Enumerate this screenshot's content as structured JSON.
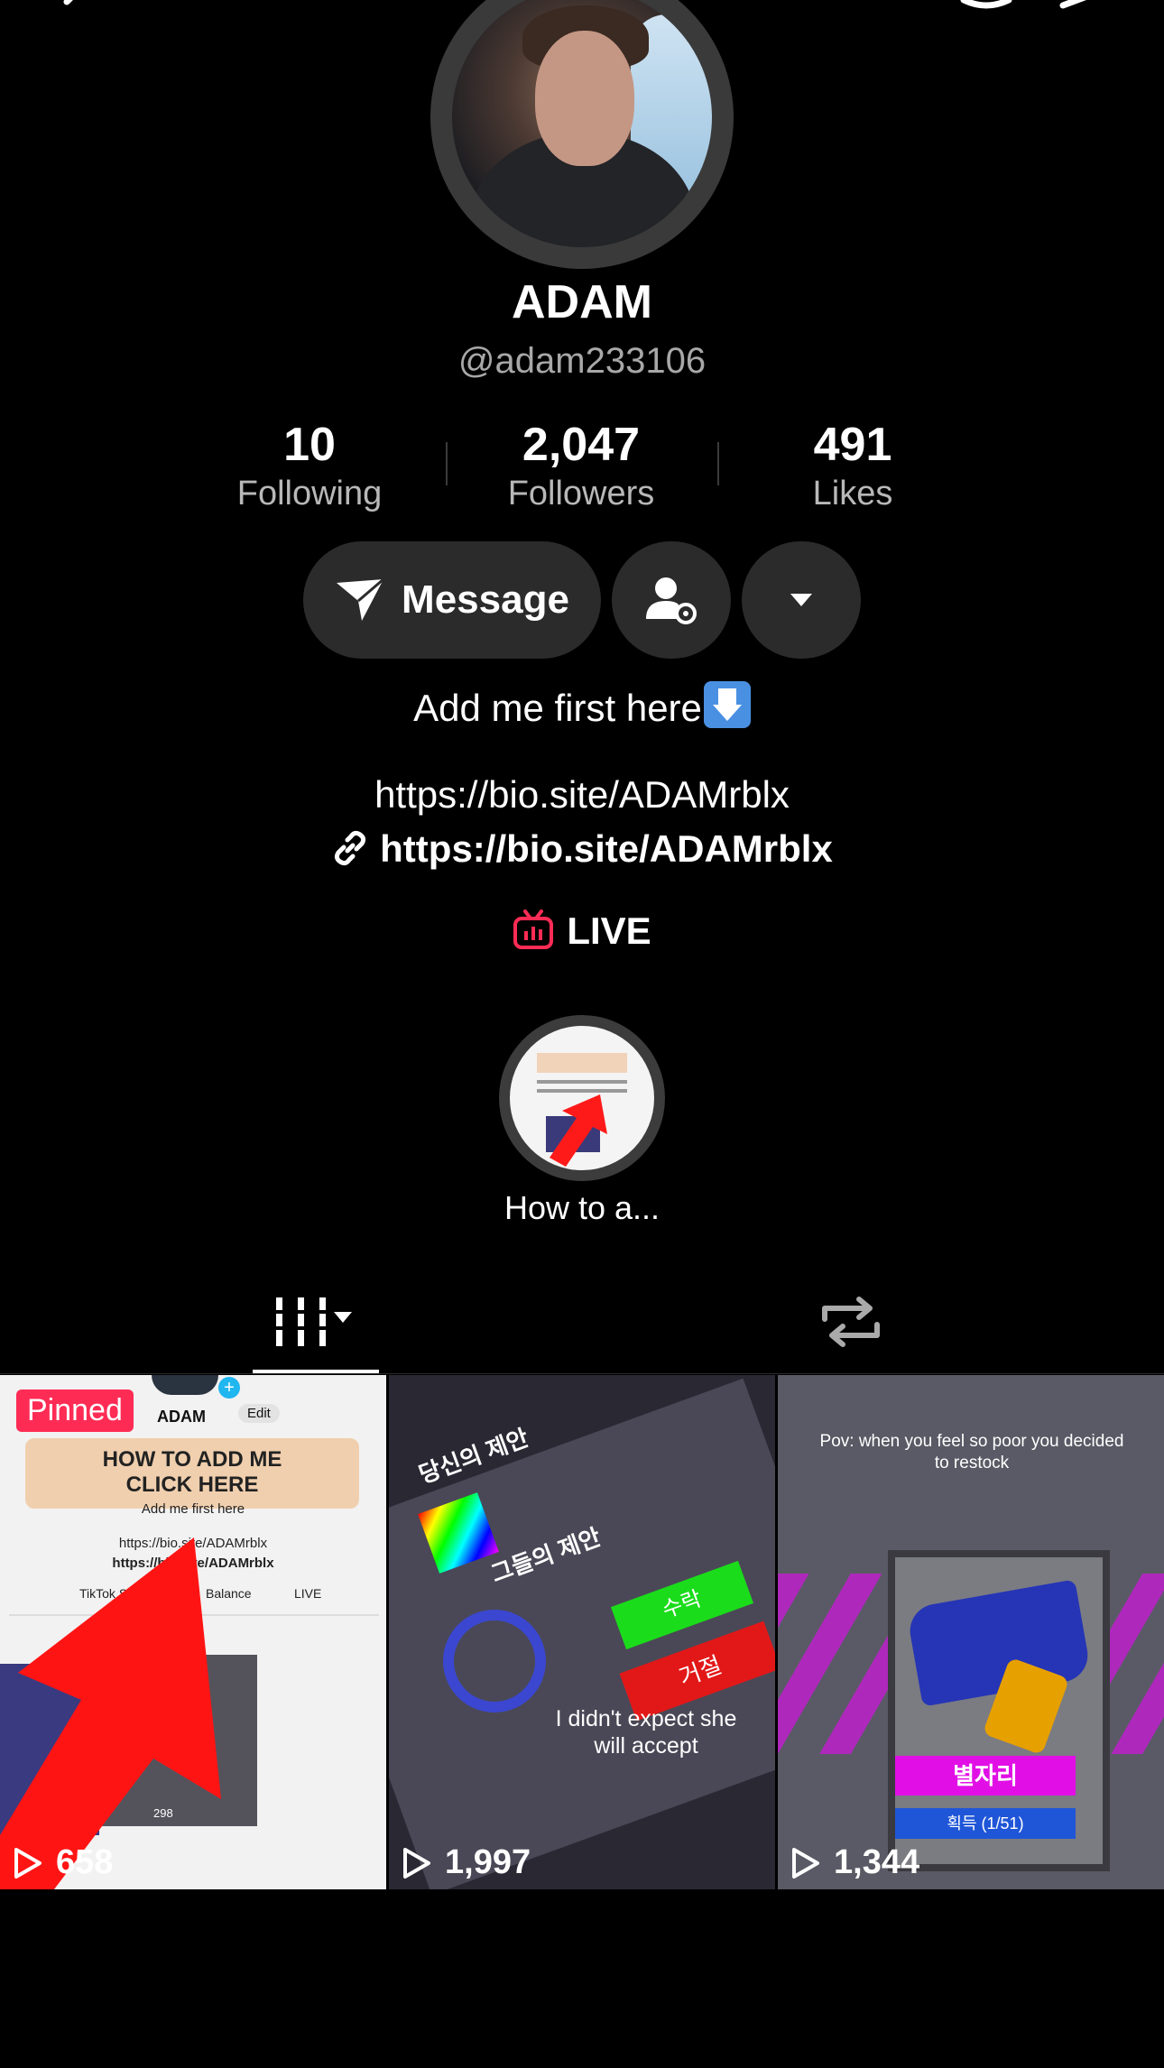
{
  "profile": {
    "name": "ADAM",
    "handle": "@adam233106",
    "bio": "Add me first here",
    "link_text": "https://bio.site/ADAMrblx",
    "link_url": "https://bio.site/ADAMrblx",
    "live_label": "LIVE"
  },
  "stats": [
    {
      "value": "10",
      "label": "Following"
    },
    {
      "value": "2,047",
      "label": "Followers"
    },
    {
      "value": "491",
      "label": "Likes"
    }
  ],
  "actions": {
    "message_label": "Message"
  },
  "highlight": {
    "label": "How to a..."
  },
  "videos": [
    {
      "pinned_label": "Pinned",
      "views": "658",
      "preview": {
        "name": "ADAM",
        "edit": "Edit",
        "title_line1": "HOW TO ADD ME",
        "title_line2": "CLICK HERE",
        "bio": "Add me first here",
        "link1": "https://bio.site/ADAMrblx",
        "link2": "https://bio.site/ADAMrblx",
        "studio": "TikTok Studi",
        "balance": "Balance",
        "live": "LIVE",
        "count": "298"
      }
    },
    {
      "views": "1,997",
      "caption": "I didn't expect she will accept",
      "labels": [
        "당신의 제안",
        "그들의 제안",
        "수락",
        "거절"
      ]
    },
    {
      "views": "1,344",
      "caption": "Pov: when you feel so poor you decided to restock",
      "item_name": "별자리",
      "item_sub": "획득 (1/51)"
    }
  ],
  "colors": {
    "accent": "#fe2c55",
    "background": "#000000",
    "button": "#2b2b2b"
  }
}
